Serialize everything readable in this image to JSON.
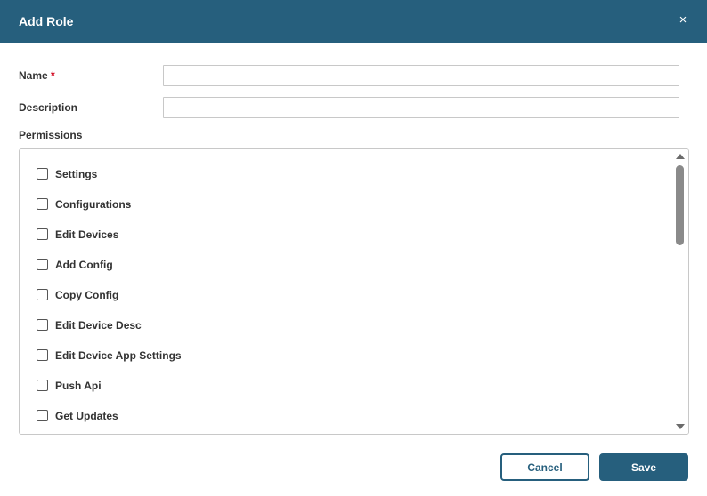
{
  "dialog": {
    "title": "Add Role",
    "close_glyph": "×",
    "close_icon": "close-icon"
  },
  "form": {
    "name_label": "Name",
    "required_marker": "*",
    "name_value": "",
    "description_label": "Description",
    "description_value": "",
    "permissions_label": "Permissions"
  },
  "permissions": [
    {
      "label": "Settings",
      "checked": false
    },
    {
      "label": "Configurations",
      "checked": false
    },
    {
      "label": "Edit Devices",
      "checked": false
    },
    {
      "label": "Add Config",
      "checked": false
    },
    {
      "label": "Copy Config",
      "checked": false
    },
    {
      "label": "Edit Device Desc",
      "checked": false
    },
    {
      "label": "Edit Device App Settings",
      "checked": false
    },
    {
      "label": "Push Api",
      "checked": false
    },
    {
      "label": "Get Updates",
      "checked": false
    }
  ],
  "footer": {
    "cancel_label": "Cancel",
    "save_label": "Save"
  },
  "colors": {
    "header_bg": "#265f7d",
    "primary": "#265f7d",
    "required": "#d0021b"
  }
}
